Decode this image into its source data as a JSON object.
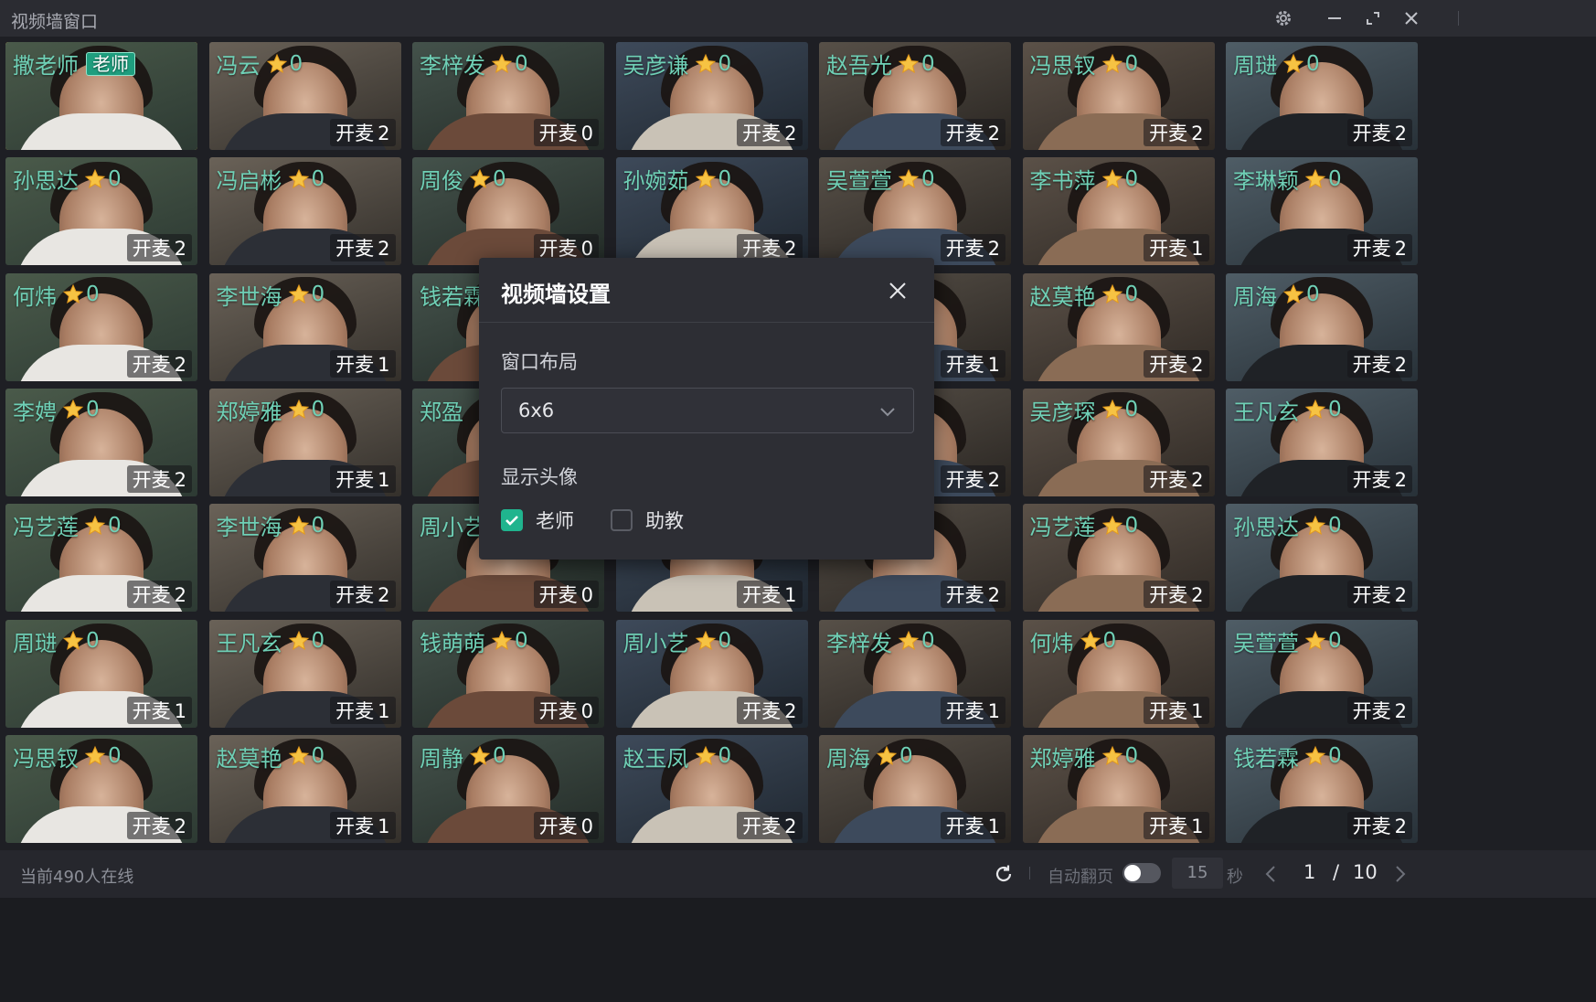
{
  "window": {
    "title": "视频墙窗口"
  },
  "titlebar_icons": [
    "gear-icon",
    "minimize-icon",
    "fullscreen-icon",
    "close-icon"
  ],
  "mic_prefix": "开麦",
  "teacher_badge": "老师",
  "colors": {
    "accent": "#20b48e",
    "name_text": "#6fd0b6",
    "teacher_border": "#f3c24b",
    "star": "#f6c343"
  },
  "tiles": [
    {
      "name": "撒老师",
      "teacher": true
    },
    {
      "name": "冯云",
      "score": "0",
      "mic": "2"
    },
    {
      "name": "李梓发",
      "score": "0",
      "mic": "0"
    },
    {
      "name": "吴彦谦",
      "score": "0",
      "mic": "2"
    },
    {
      "name": "赵吾光",
      "score": "0",
      "mic": "2"
    },
    {
      "name": "冯思钗",
      "score": "0",
      "mic": "2"
    },
    {
      "name": "周琎",
      "score": "0",
      "mic": "2"
    },
    {
      "name": "孙思达",
      "score": "0",
      "mic": "2"
    },
    {
      "name": "冯启彬",
      "score": "0",
      "mic": "2"
    },
    {
      "name": "周俊",
      "score": "0",
      "mic": "0"
    },
    {
      "name": "孙婉茹",
      "score": "0",
      "mic": "2"
    },
    {
      "name": "吴萱萱",
      "score": "0",
      "mic": "2"
    },
    {
      "name": "李书萍",
      "score": "0",
      "mic": "1"
    },
    {
      "name": "李琳颖",
      "score": "0",
      "mic": "2"
    },
    {
      "name": "何炜",
      "score": "0",
      "mic": "2"
    },
    {
      "name": "李世海",
      "score": "0",
      "mic": "1"
    },
    {
      "name": "钱若霖",
      "score": "",
      "mic": ""
    },
    {
      "name": "",
      "score": "",
      "mic": ""
    },
    {
      "name": "",
      "score": "",
      "mic": "1"
    },
    {
      "name": "赵莫艳",
      "score": "0",
      "mic": "2"
    },
    {
      "name": "周海",
      "score": "0",
      "mic": "2"
    },
    {
      "name": "李娉",
      "score": "0",
      "mic": "2"
    },
    {
      "name": "郑婷雅",
      "score": "0",
      "mic": "1"
    },
    {
      "name": "郑盈",
      "score": "",
      "mic": ""
    },
    {
      "name": "",
      "score": "",
      "mic": ""
    },
    {
      "name": "",
      "score": "",
      "mic": "2"
    },
    {
      "name": "吴彦琛",
      "score": "0",
      "mic": "2"
    },
    {
      "name": "王凡玄",
      "score": "0",
      "mic": "2"
    },
    {
      "name": "冯艺莲",
      "score": "0",
      "mic": "2"
    },
    {
      "name": "李世海",
      "score": "0",
      "mic": "2"
    },
    {
      "name": "周小艺",
      "score": "",
      "mic": "0"
    },
    {
      "name": "",
      "score": "",
      "mic": "1"
    },
    {
      "name": "",
      "score": "",
      "mic": "2"
    },
    {
      "name": "冯艺莲",
      "score": "0",
      "mic": "2"
    },
    {
      "name": "孙思达",
      "score": "0",
      "mic": "2"
    },
    {
      "name": "周琎",
      "score": "0",
      "mic": "1"
    },
    {
      "name": "王凡玄",
      "score": "0",
      "mic": "1"
    },
    {
      "name": "钱萌萌",
      "score": "0",
      "mic": "0"
    },
    {
      "name": "周小艺",
      "score": "0",
      "mic": "2"
    },
    {
      "name": "李梓发",
      "score": "0",
      "mic": "1"
    },
    {
      "name": "何炜",
      "score": "0",
      "mic": "1"
    },
    {
      "name": "吴萱萱",
      "score": "0",
      "mic": "2"
    },
    {
      "name": "冯思钗",
      "score": "0",
      "mic": "2"
    },
    {
      "name": "赵莫艳",
      "score": "0",
      "mic": "1"
    },
    {
      "name": "周静",
      "score": "0",
      "mic": "0"
    },
    {
      "name": "赵玉凤",
      "score": "0",
      "mic": "2"
    },
    {
      "name": "周海",
      "score": "0",
      "mic": "1"
    },
    {
      "name": "郑婷雅",
      "score": "0",
      "mic": "1"
    },
    {
      "name": "钱若霖",
      "score": "0",
      "mic": "2"
    }
  ],
  "modal": {
    "title": "视频墙设置",
    "layout_label": "窗口布局",
    "layout_value": "6x6",
    "avatar_label": "显示头像",
    "opt_teacher": "老师",
    "opt_assistant": "助教",
    "teacher_checked": true,
    "assistant_checked": false
  },
  "footer": {
    "online": "当前490人在线",
    "auto_flip": "自动翻页",
    "auto_flip_on": false,
    "seconds_value": "15",
    "seconds_unit": "秒",
    "page": "1",
    "slash": "/",
    "total": "10"
  }
}
